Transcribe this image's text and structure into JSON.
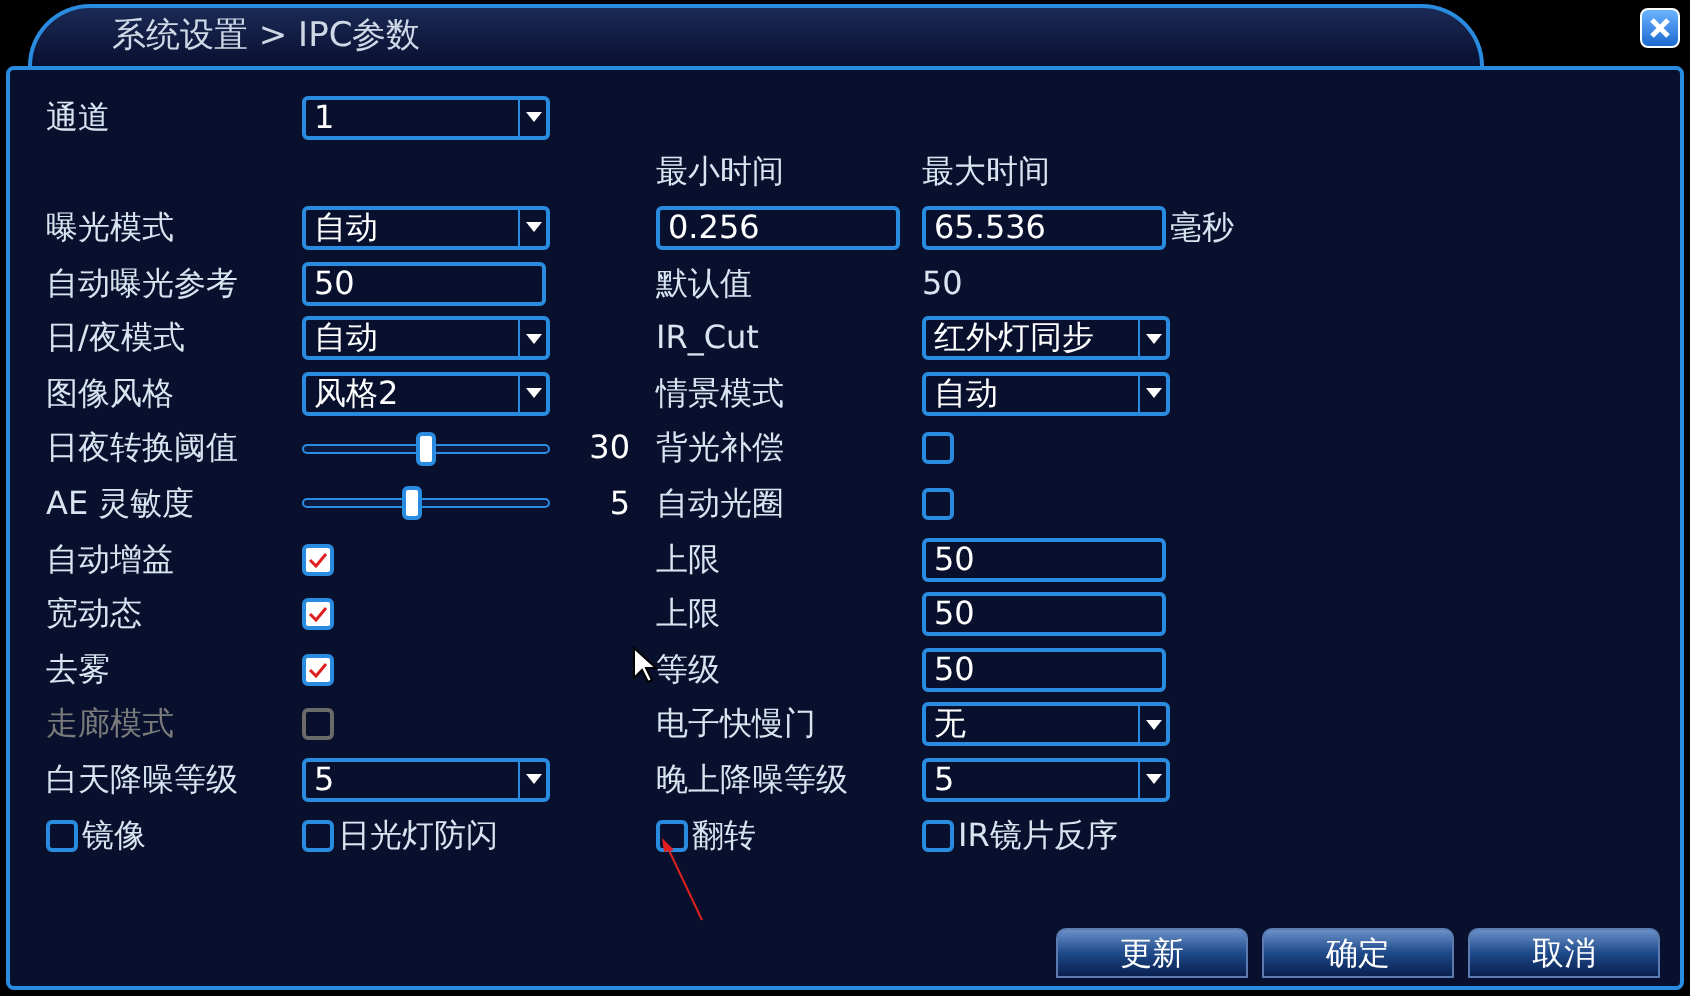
{
  "window": {
    "title": "系统设置 > IPC参数"
  },
  "rows": [
    {
      "disabled": false,
      "left": [
        {
          "kind": "text",
          "text": "通道"
        },
        {
          "kind": "select",
          "value": "1"
        }
      ],
      "right": []
    },
    {
      "left": [],
      "right": [
        {
          "kind": "text",
          "text": "最小时间"
        },
        {
          "kind": "text",
          "text": "最大时间"
        }
      ]
    },
    {
      "disabled": false,
      "left": [
        {
          "kind": "text",
          "text": "曝光模式"
        },
        {
          "kind": "select",
          "value": "自动"
        }
      ],
      "right": [
        {
          "kind": "input",
          "value": "0.256"
        },
        {
          "kind": "input",
          "value": "65.536"
        },
        {
          "kind": "text",
          "text": "毫秒"
        }
      ]
    },
    {
      "disabled": false,
      "left": [
        {
          "kind": "text",
          "text": "自动曝光参考"
        },
        {
          "kind": "input",
          "value": "50"
        }
      ],
      "right": [
        {
          "kind": "text",
          "text": "默认值"
        },
        {
          "kind": "text",
          "text": "50"
        }
      ]
    },
    {
      "disabled": false,
      "left": [
        {
          "kind": "text",
          "text": "日/夜模式"
        },
        {
          "kind": "select",
          "value": "自动"
        }
      ],
      "right": [
        {
          "kind": "text",
          "text": "IR_Cut"
        },
        {
          "kind": "select",
          "value": "红外灯同步"
        }
      ]
    },
    {
      "disabled": false,
      "left": [
        {
          "kind": "text",
          "text": "图像风格"
        },
        {
          "kind": "select",
          "value": "风格2"
        }
      ],
      "right": [
        {
          "kind": "text",
          "text": "情景模式"
        },
        {
          "kind": "select",
          "value": "自动"
        }
      ]
    },
    {
      "disabled": false,
      "left": [
        {
          "kind": "text",
          "text": "日夜转换阈值"
        },
        {
          "kind": "slider",
          "level": 0.5,
          "reading": "30"
        }
      ],
      "right": [
        {
          "kind": "text",
          "text": "背光补偿"
        },
        {
          "kind": "checkbox",
          "checked": false
        }
      ]
    },
    {
      "disabled": false,
      "left": [
        {
          "kind": "text",
          "text": "AE 灵敏度"
        },
        {
          "kind": "slider",
          "level": 0.44,
          "reading": "5"
        }
      ],
      "right": [
        {
          "kind": "text",
          "text": "自动光圈"
        },
        {
          "kind": "checkbox",
          "checked": false
        }
      ]
    },
    {
      "disabled": false,
      "left": [
        {
          "kind": "text",
          "text": "自动增益"
        },
        {
          "kind": "checkbox",
          "checked": true
        }
      ],
      "right": [
        {
          "kind": "text",
          "text": "上限"
        },
        {
          "kind": "input",
          "value": "50"
        }
      ]
    },
    {
      "disabled": false,
      "left": [
        {
          "kind": "text",
          "text": "宽动态"
        },
        {
          "kind": "checkbox",
          "checked": true
        }
      ],
      "right": [
        {
          "kind": "text",
          "text": "上限"
        },
        {
          "kind": "input",
          "value": "50"
        }
      ]
    },
    {
      "disabled": false,
      "left": [
        {
          "kind": "text",
          "text": "去雾"
        },
        {
          "kind": "checkbox",
          "checked": true
        }
      ],
      "right": [
        {
          "kind": "text",
          "text": "等级"
        },
        {
          "kind": "input",
          "value": "50"
        }
      ]
    },
    {
      "disabled": true,
      "left": [
        {
          "kind": "text",
          "text": "走廊模式"
        },
        {
          "kind": "checkbox",
          "checked": false
        }
      ],
      "right": [
        {
          "kind": "text",
          "text": "电子快慢门"
        },
        {
          "kind": "select",
          "value": "无"
        }
      ]
    },
    {
      "disabled": false,
      "left": [
        {
          "kind": "text",
          "text": "白天降噪等级"
        },
        {
          "kind": "select",
          "value": "5"
        }
      ],
      "right": [
        {
          "kind": "text",
          "text": "晚上降噪等级"
        },
        {
          "kind": "select",
          "value": "5"
        }
      ]
    },
    {
      "disabled": false,
      "left": [
        {
          "kind": "check_label",
          "text": "镜像",
          "checked": false
        },
        {
          "kind": "check_label",
          "text": "日光灯防闪",
          "checked": false
        }
      ],
      "right": [
        {
          "kind": "check_label",
          "text": "翻转",
          "checked": false
        },
        {
          "kind": "check_label",
          "text": "IR镜片反序",
          "checked": false
        }
      ]
    }
  ],
  "buttons": [
    "更新",
    "确定",
    "取消"
  ]
}
